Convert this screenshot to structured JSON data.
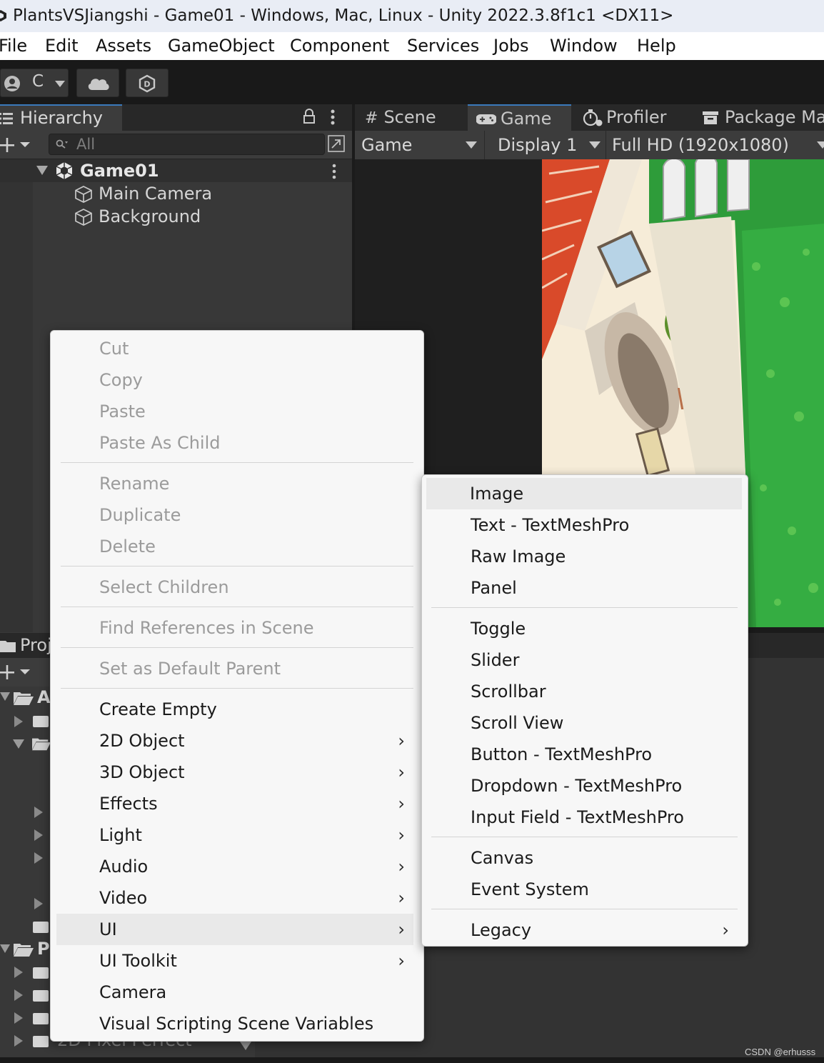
{
  "window": {
    "title": "PlantsVSJiangshi - Game01 - Windows, Mac, Linux - Unity 2022.3.8f1c1 <DX11>"
  },
  "menubar": [
    "File",
    "Edit",
    "Assets",
    "GameObject",
    "Component",
    "Services",
    "Jobs",
    "Window",
    "Help"
  ],
  "toolbar": {
    "account_initial": "C"
  },
  "hierarchy": {
    "tab_label": "Hierarchy",
    "search_placeholder": "All",
    "scene_name": "Game01",
    "items": [
      "Main Camera",
      "Background"
    ]
  },
  "game_view": {
    "tabs": [
      "Scene",
      "Game",
      "Profiler",
      "Package Ma"
    ],
    "view_mode": "Game",
    "display": "Display 1",
    "resolution": "Full HD (1920x1080)"
  },
  "project": {
    "tab_label": "Proj",
    "tree_labels": [
      "A",
      "P",
      "2D Pixel Perfect"
    ]
  },
  "context_menu": {
    "group1": [
      "Cut",
      "Copy",
      "Paste",
      "Paste As Child"
    ],
    "group2": [
      "Rename",
      "Duplicate",
      "Delete"
    ],
    "group3": [
      "Select Children"
    ],
    "group4": [
      "Find References in Scene"
    ],
    "group5": [
      "Set as Default Parent"
    ],
    "group6": [
      {
        "label": "Create Empty",
        "submenu": false
      },
      {
        "label": "2D Object",
        "submenu": true
      },
      {
        "label": "3D Object",
        "submenu": true
      },
      {
        "label": "Effects",
        "submenu": true
      },
      {
        "label": "Light",
        "submenu": true
      },
      {
        "label": "Audio",
        "submenu": true
      },
      {
        "label": "Video",
        "submenu": true
      },
      {
        "label": "UI",
        "submenu": true,
        "highlighted": true
      },
      {
        "label": "UI Toolkit",
        "submenu": true
      },
      {
        "label": "Camera",
        "submenu": false
      },
      {
        "label": "Visual Scripting Scene Variables",
        "submenu": false
      }
    ],
    "arrow_glyph": "›"
  },
  "ui_submenu": {
    "group1": [
      "Image",
      "Text - TextMeshPro",
      "Raw Image",
      "Panel"
    ],
    "group2": [
      "Toggle",
      "Slider",
      "Scrollbar",
      "Scroll View",
      "Button - TextMeshPro",
      "Dropdown - TextMeshPro",
      "Input Field - TextMeshPro"
    ],
    "group3": [
      "Canvas",
      "Event System"
    ],
    "group4": [
      "Legacy"
    ],
    "highlighted": "Image"
  },
  "watermark": "CSDN @erhusss",
  "colors": {
    "editor_bg": "#383838",
    "accent": "#3a79bb",
    "menu_bg": "#f7f7f7",
    "menu_disabled": "#9b9b9b",
    "lawn_green": "#2e9c3a",
    "roof_red": "#d94a2a"
  }
}
